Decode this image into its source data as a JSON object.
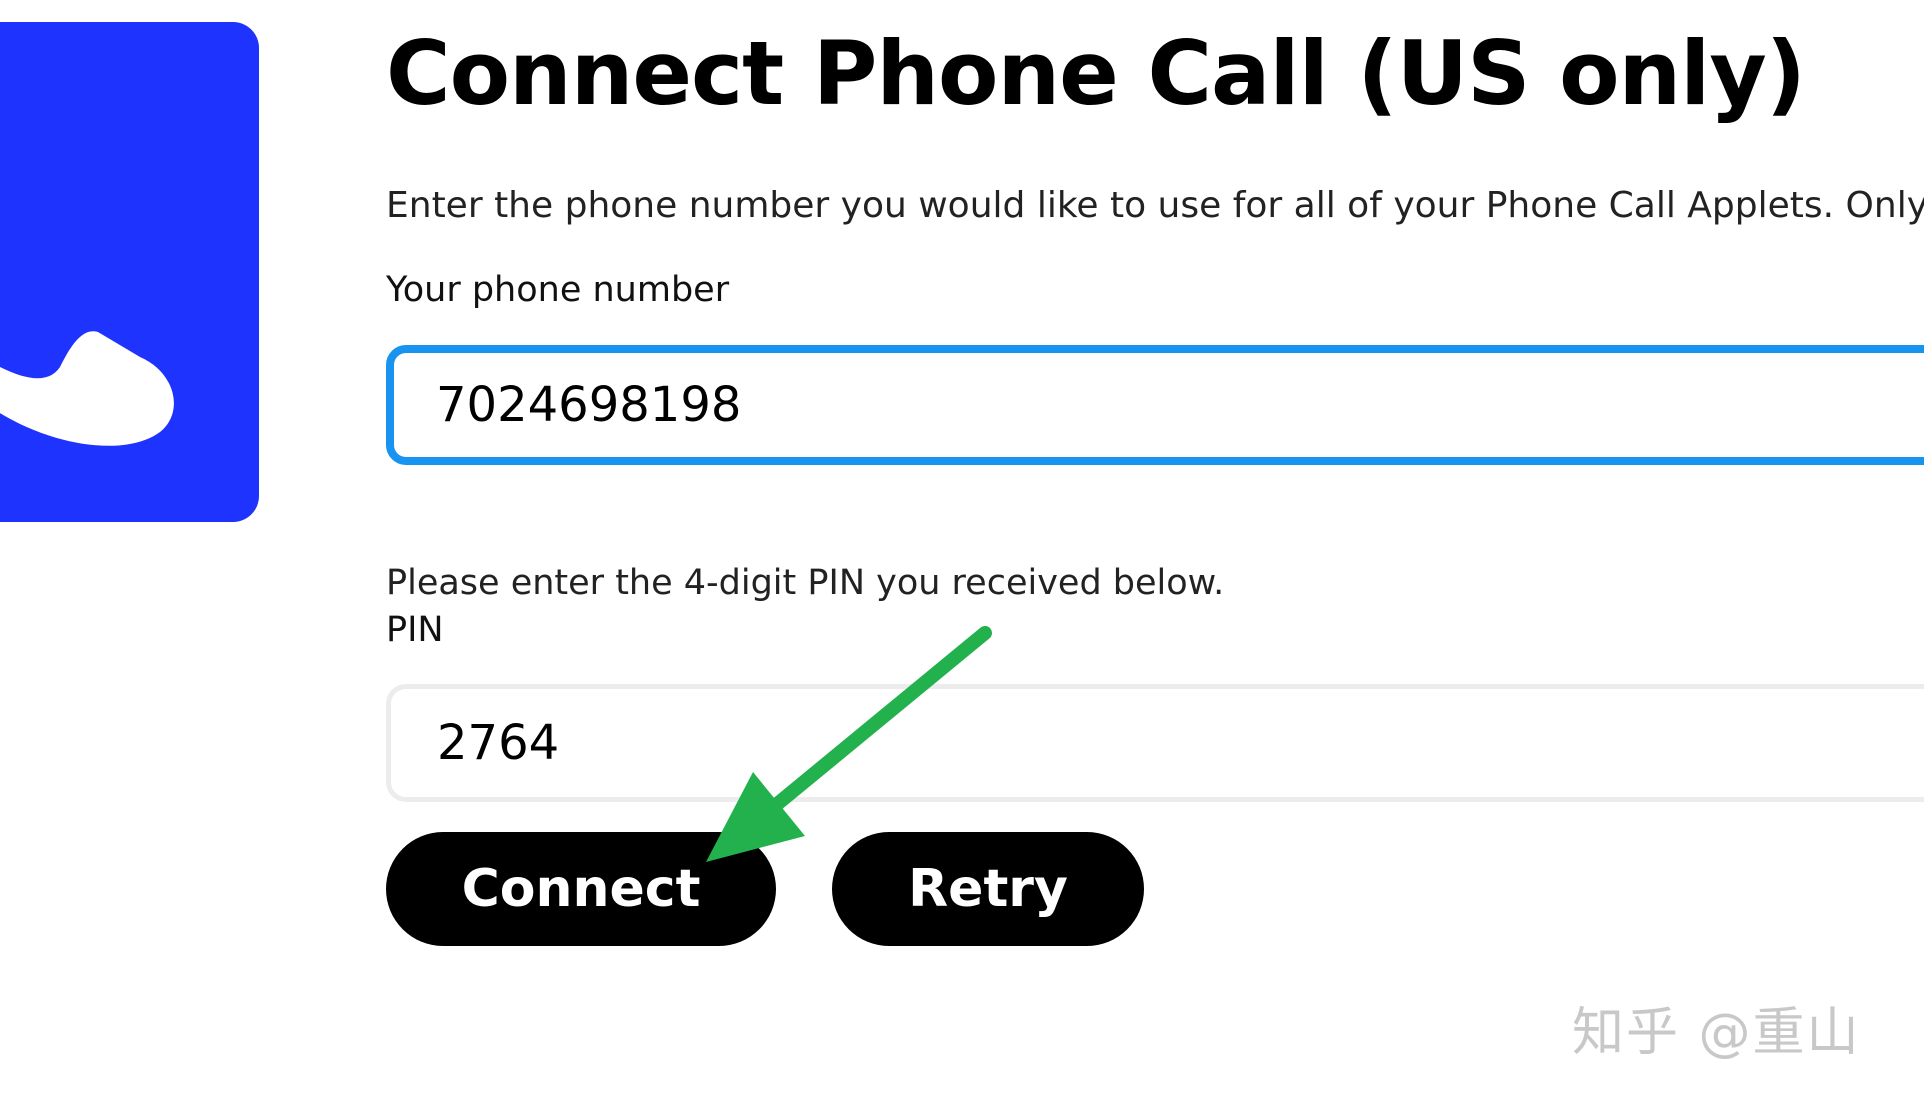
{
  "service": {
    "icon": "phone-handset-icon",
    "tile_color": "#1f33ff"
  },
  "header": {
    "title": "Connect Phone Call (US only)"
  },
  "form": {
    "intro": "Enter the phone number you would like to use for all of your Phone Call Applets. Only US bas",
    "phone_label": "Your phone number",
    "phone_value": "7024698198",
    "pin_helper": "Please enter the 4-digit PIN you received below.",
    "pin_label": "PIN",
    "pin_value": "2764",
    "focus_color": "#1893f0"
  },
  "actions": {
    "connect_label": "Connect",
    "retry_label": "Retry"
  },
  "annotation": {
    "arrow_color": "#22b14c"
  },
  "watermark": {
    "text": "知乎 @重山"
  }
}
